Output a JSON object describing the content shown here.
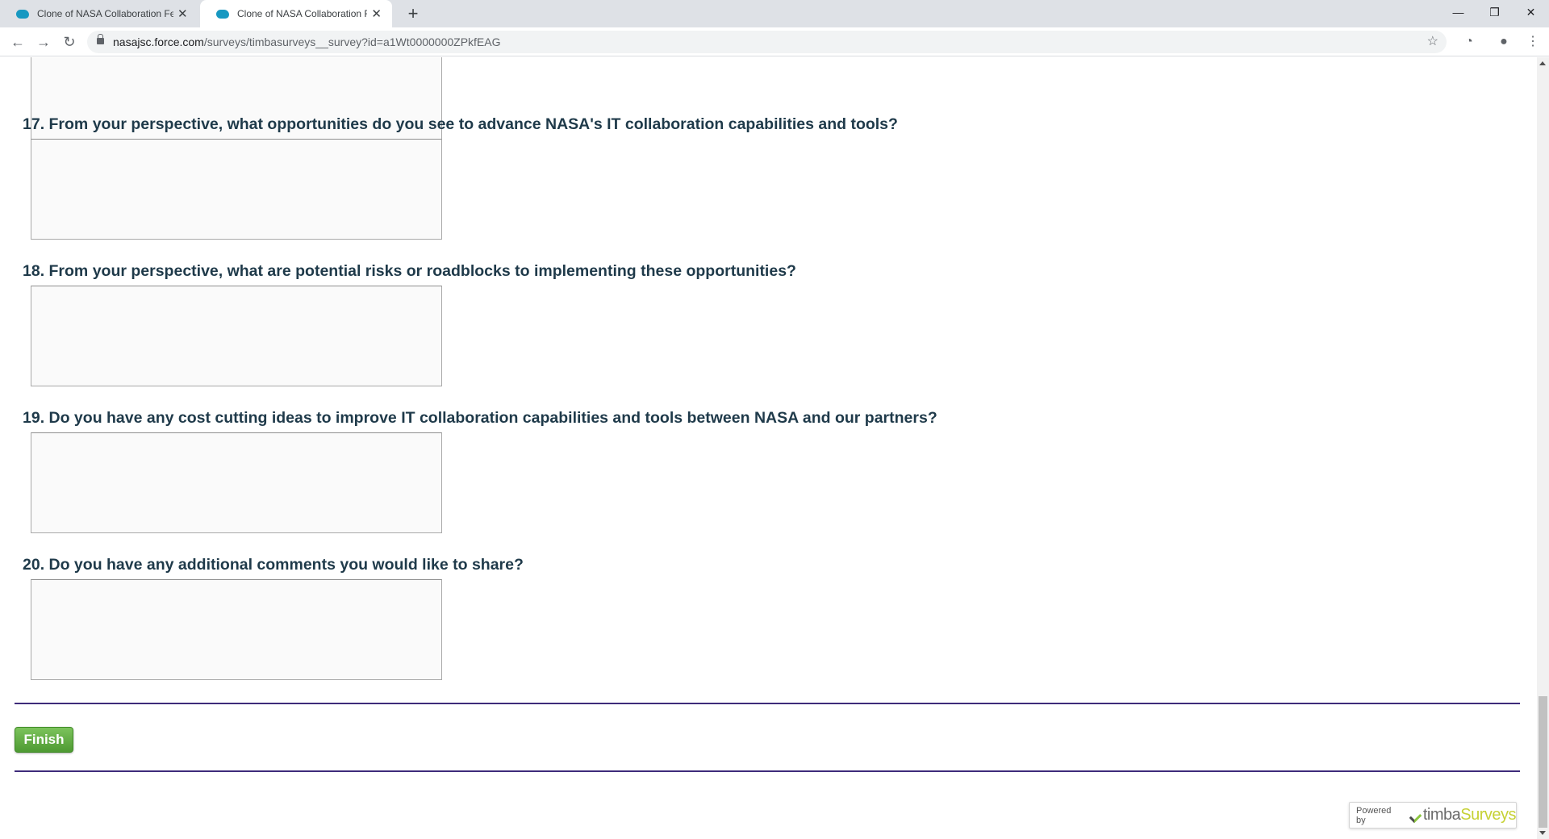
{
  "browser": {
    "tabs": [
      {
        "title": "Clone of NASA Collaboration Fee",
        "active": false
      },
      {
        "title": "Clone of NASA Collaboration Fee",
        "active": true
      }
    ],
    "new_tab_icon": "+",
    "window_controls": {
      "minimize": "—",
      "restore": "❐",
      "close": "✕"
    },
    "url_host": "nasajsc.force.com",
    "url_path": "/surveys/timbasurveys__survey?id=a1Wt0000000ZPkfEAG"
  },
  "survey": {
    "questions": [
      {
        "label": "17. From your perspective, what opportunities do you see to advance NASA's IT collaboration capabilities and tools?"
      },
      {
        "label": "18. From your perspective, what are potential risks or roadblocks to implementing these opportunities?"
      },
      {
        "label": "19. Do you have any cost cutting ideas to improve IT collaboration capabilities and tools between NASA and our partners?"
      },
      {
        "label": "20. Do you have any additional comments you would like to share?"
      }
    ],
    "finish_label": "Finish"
  },
  "footer": {
    "powered_by": "Powered by",
    "brand_part1": "timba",
    "brand_part2": "Surveys"
  },
  "colors": {
    "question_text": "#1f3a4a",
    "divider": "#3e2b7a",
    "finish_button": "#5aab3b",
    "brand_accent": "#c6d135"
  }
}
